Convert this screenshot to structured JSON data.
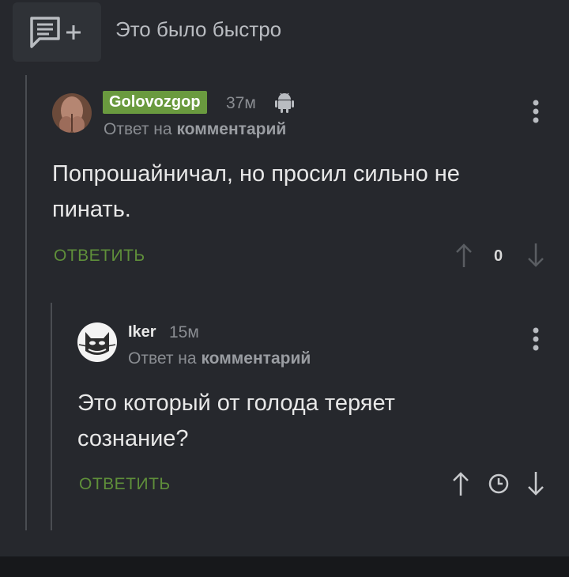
{
  "header": {
    "title": "Это было быстро"
  },
  "comments": [
    {
      "username": "Golovozgop",
      "time": "37м",
      "reply_prefix": "Ответ на",
      "reply_target": "комментарий",
      "text_line1": "Попрошайничал, но просил сильно не",
      "text_line2": "пинать.",
      "reply_label": "ОТВЕТИТЬ",
      "score": "0"
    },
    {
      "username": "Iker",
      "time": "15м",
      "reply_prefix": "Ответ на",
      "reply_target": "комментарий",
      "text_line1": "Это который от голода теряет",
      "text_line2": "сознание?",
      "reply_label": "ОТВЕТИТЬ"
    }
  ],
  "colors": {
    "background": "#26282d",
    "accent_green": "#6a9a3f",
    "muted_text": "#8a8d92"
  }
}
